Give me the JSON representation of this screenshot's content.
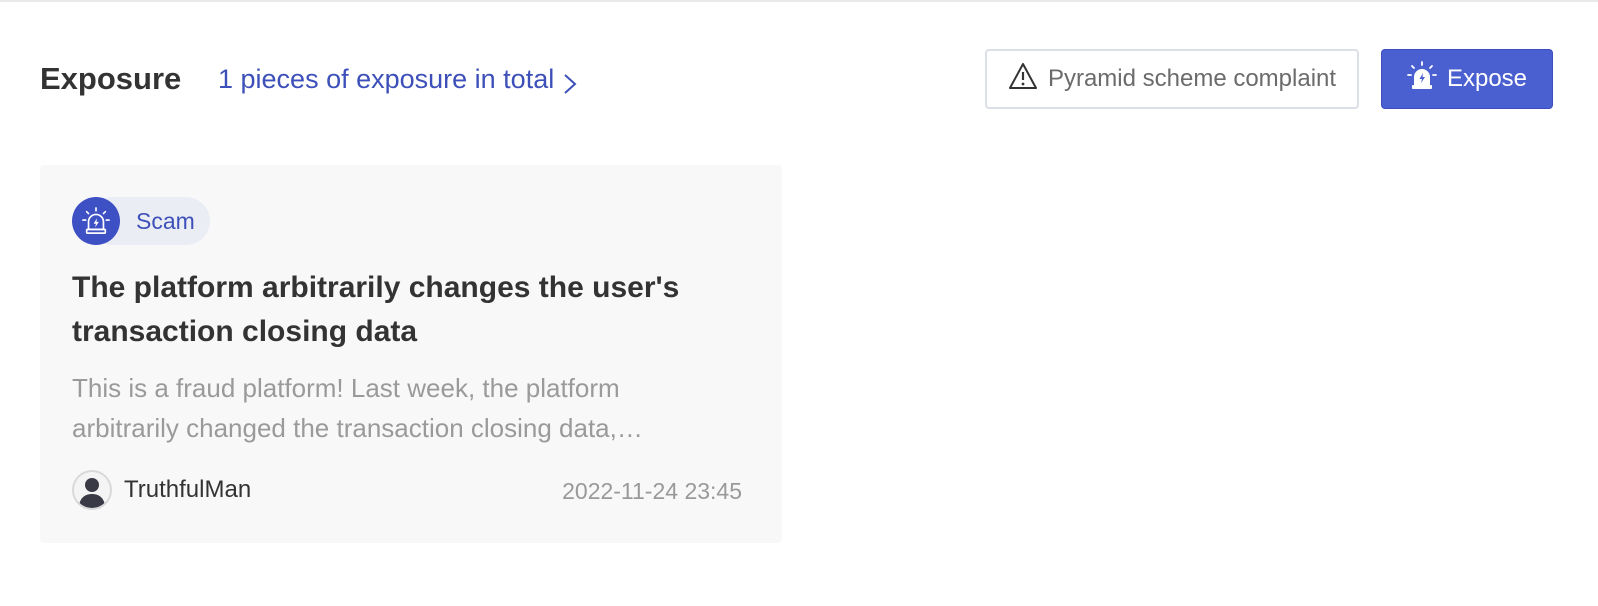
{
  "header": {
    "title": "Exposure",
    "summary_link": "1 pieces of exposure in total",
    "complaint_button": "Pyramid scheme complaint",
    "expose_button": "Expose"
  },
  "cards": [
    {
      "tag": "Scam",
      "title": "The platform arbitrarily changes the user's transaction closing data",
      "excerpt": "This is a fraud platform! Last week, the platform arbitrarily changed the transaction closing data,…",
      "author": "TruthfulMan",
      "date": "2022-11-24 23:45"
    }
  ],
  "icons": {
    "summary_link": "chevron-right-icon",
    "complaint_button": "warning-triangle-icon",
    "expose_button": "siren-alarm-icon",
    "tag": "siren-alarm-icon",
    "author": "user-avatar-icon"
  },
  "colors": {
    "accent": "#4a5fd0",
    "link": "#3d50b9",
    "card_background": "#f8f8f9",
    "tag_pill": "#ebedf5",
    "muted_text": "#9a9a9a"
  }
}
